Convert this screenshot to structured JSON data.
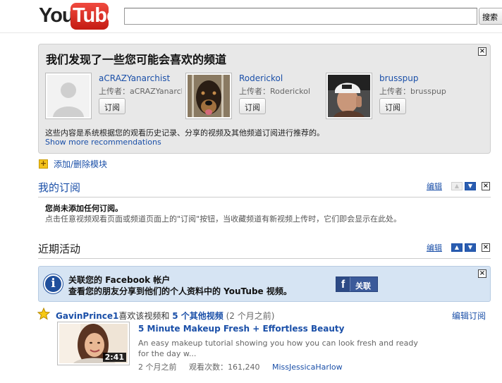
{
  "header": {
    "logo_you": "You",
    "logo_tube": "Tube",
    "search_value": "",
    "search_button": "搜索"
  },
  "recommendations": {
    "title": "我们发现了一些您可能会喜欢的频道",
    "channels": [
      {
        "name": "aCRAZYanarchist",
        "uploader": "上传者：aCRAZYanarchist",
        "subscribe": "订阅"
      },
      {
        "name": "Roderickol",
        "uploader": "上传者：Roderickol",
        "subscribe": "订阅"
      },
      {
        "name": "brusspup",
        "uploader": "上传者：brusspup",
        "subscribe": "订阅"
      }
    ],
    "description": "这些内容是系统根据您的观看历史记录、分享的视频及其他频道订阅进行推荐的。",
    "more_link": "Show more recommendations"
  },
  "add_module": "添加/删除模块",
  "subscriptions": {
    "title": "我的订阅",
    "edit": "编辑",
    "empty_title": "您尚未添加任何订阅。",
    "empty_desc": "点击任意视频观看页面或频道页面上的\"订阅\"按钮，当收藏频道有新视频上传时，它们即会显示在此处。"
  },
  "activity": {
    "title": "近期活动",
    "edit": "编辑",
    "facebook": {
      "line1": "关联您的 Facebook 帐户",
      "line2": "查看您的朋友分享到他们的个人资料中的 YouTube 视频。",
      "connect": "关联"
    },
    "item": {
      "user": "GavinPrince1",
      "action": "喜欢该视频和",
      "more": "5 个其他视频",
      "time": "(2 个月之前)",
      "edit_sub": "编辑订阅"
    },
    "video": {
      "title": "5 Minute Makeup Fresh + Effortless Beauty",
      "desc": "An easy makeup tutorial showing you how you can look fresh and ready for the day w...",
      "duration": "2:41",
      "age": "2 个月之前",
      "views": "观看次数：161,240",
      "author": "MissJessicaHarlow"
    }
  },
  "colors": {
    "link": "#1a4fa8",
    "logo_red": "#e62117",
    "panel_gray": "#e8e8e8",
    "facebook_panel": "#d6e4f3",
    "facebook_blue": "#3b5a9a"
  }
}
